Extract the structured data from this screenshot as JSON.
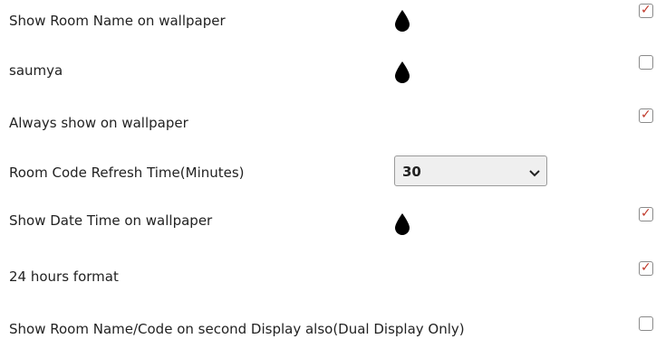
{
  "settings": [
    {
      "label": "Show Room Name on wallpaper",
      "icon": "droplet-icon",
      "checked": true
    },
    {
      "label": "saumya",
      "icon": "droplet-icon",
      "checked": false
    },
    {
      "label": "Always show on wallpaper",
      "checked": true
    },
    {
      "label": "Room Code Refresh Time(Minutes)",
      "select_value": "30"
    },
    {
      "label": "Show Date Time on wallpaper",
      "icon": "droplet-icon",
      "checked": true
    },
    {
      "label": "24 hours format",
      "checked": true
    },
    {
      "label": "Show Room Name/Code on second Display also(Dual Display Only)",
      "checked": false
    }
  ],
  "colors": {
    "checkmark": "#c0392b",
    "text": "#222222",
    "icon": "#000000"
  }
}
